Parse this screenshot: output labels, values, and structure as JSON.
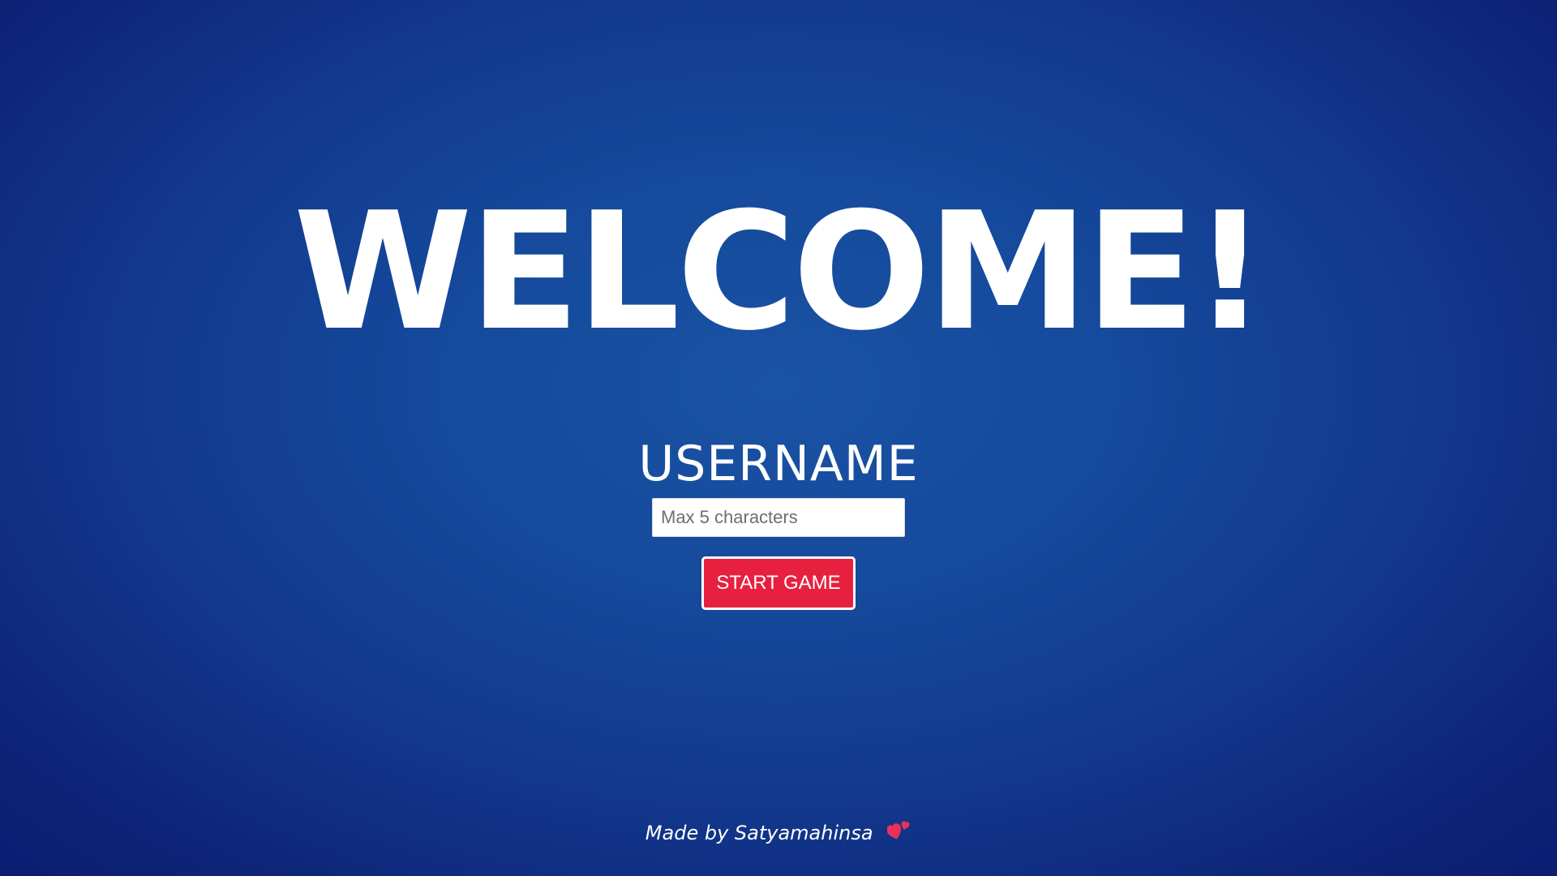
{
  "welcome": {
    "title": "WELCOME!"
  },
  "form": {
    "username_label": "USERNAME",
    "username_value": "",
    "username_placeholder": "Max 5 characters",
    "start_button_label": "START GAME"
  },
  "footer": {
    "credit_text": "Made by Satyamahinsa",
    "icon": "two-hearts-icon"
  },
  "colors": {
    "background": "#154a9c",
    "background_edge": "#0c1d72",
    "button": "#e8203f",
    "heart": "#e8305a",
    "text": "#ffffff"
  }
}
